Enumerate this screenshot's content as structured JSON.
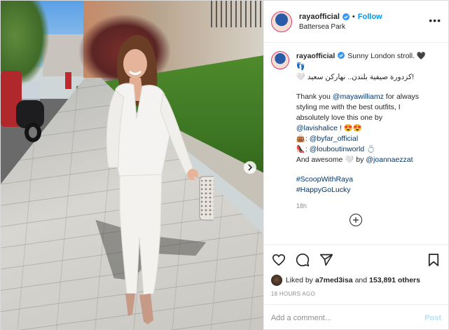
{
  "header": {
    "username": "rayaofficial",
    "follow_separator": "•",
    "follow_label": "Follow",
    "location": "Battersea Park",
    "more_label": "•••"
  },
  "caption": {
    "username": "rayaofficial",
    "lines": [
      {
        "text": "Sunny London stroll. 🖤",
        "type": "inline"
      },
      {
        "text": "👣",
        "type": "plain"
      },
      {
        "text": "!كزدورة صيفية بلندن.. نهاركن سعيد 🤍",
        "type": "arabic"
      },
      {
        "text": "",
        "type": "spacer"
      },
      {
        "text": "Thank you ",
        "link": "@mayawilliamz",
        "after": " for always",
        "type": "mixed"
      },
      {
        "text": "styling me with the best outfits, I",
        "type": "plain"
      },
      {
        "text": "absolutely love this one by",
        "type": "plain"
      },
      {
        "text": "",
        "link": "@lavishalice",
        "after": " ! 😍😍",
        "type": "mixed"
      },
      {
        "text": "👜: ",
        "link": "@byfar_official",
        "after": "",
        "type": "mixed"
      },
      {
        "text": "👠: ",
        "link": "@louboutinworld",
        "after": " 💍",
        "type": "mixed"
      },
      {
        "text": "And awesome 🤍 by ",
        "link": "@joannaezzat",
        "after": "",
        "type": "mixed"
      },
      {
        "text": "",
        "type": "spacer"
      },
      {
        "text": "",
        "link": "#ScoopWithRaya",
        "after": "",
        "type": "mixed"
      },
      {
        "text": "",
        "link": "#HappyGoLucky",
        "after": "",
        "type": "mixed"
      }
    ],
    "relative_time": "18h"
  },
  "actions": {
    "icons": [
      "heart-icon",
      "comment-icon",
      "share-icon",
      "bookmark-icon"
    ],
    "liked_by_prefix": "Liked by ",
    "liked_by_user": "a7med3isa",
    "liked_by_middle": " and ",
    "liked_by_count": "153,891 others",
    "post_time": "18 HOURS AGO"
  },
  "comment": {
    "placeholder": "Add a comment...",
    "post_label": "Post"
  },
  "colors": {
    "accent": "#0095f6",
    "link": "#00376b",
    "muted": "#8e8e8e",
    "border": "#efefef",
    "post_disabled": "#b2dffc"
  }
}
